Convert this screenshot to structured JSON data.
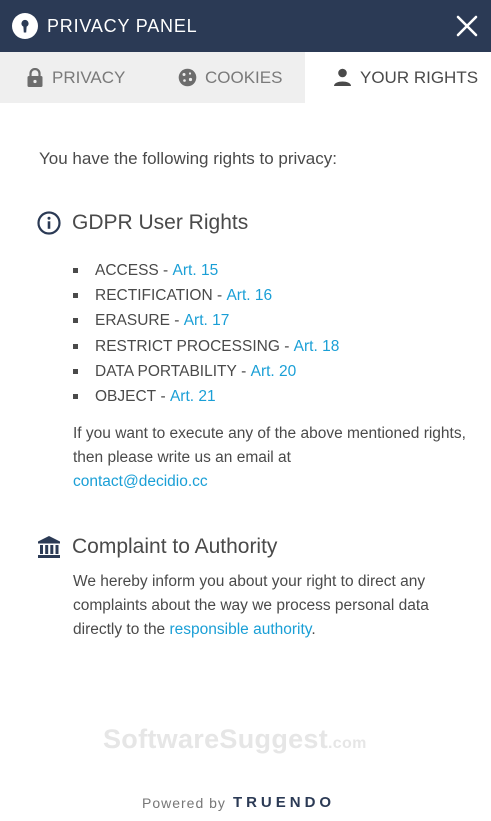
{
  "header": {
    "title": "PRIVACY PANEL",
    "close_icon": "close-icon",
    "logo_icon": "keyhole-icon"
  },
  "tabs": [
    {
      "label": "PRIVACY",
      "icon": "lock-icon",
      "active": false
    },
    {
      "label": "COOKIES",
      "icon": "cookie-icon",
      "active": false
    },
    {
      "label": "YOUR RIGHTS",
      "icon": "user-icon",
      "active": true
    }
  ],
  "content": {
    "intro": "You have the following rights to privacy:",
    "gdpr": {
      "icon": "info-icon",
      "title": "GDPR User Rights",
      "rights": [
        {
          "name": "ACCESS",
          "article": "Art. 15"
        },
        {
          "name": "RECTIFICATION",
          "article": "Art. 16"
        },
        {
          "name": "ERASURE",
          "article": "Art. 17"
        },
        {
          "name": "RESTRICT PROCESSING",
          "article": "Art. 18"
        },
        {
          "name": "DATA PORTABILITY",
          "article": "Art. 20"
        },
        {
          "name": "OBJECT",
          "article": "Art. 21"
        }
      ],
      "separator": " - ",
      "paragraph": "If you want to execute any of the above mentioned rights, then please write us an email at",
      "email": "contact@decidio.cc"
    },
    "complaint": {
      "icon": "bank-icon",
      "title": "Complaint to Authority",
      "paragraph": "We hereby inform you about your right to direct any complaints about the way we process personal data directly to the",
      "link": "responsible authority",
      "after_link": "."
    }
  },
  "watermark": {
    "name": "SoftwareSuggest",
    "suffix": ".com"
  },
  "footer": {
    "powered_by": "Powered by",
    "brand": "TRUENDO"
  },
  "colors": {
    "header_bg": "#2b3a55",
    "link": "#1a9fd6",
    "inactive_tab_bg": "#efefef"
  }
}
